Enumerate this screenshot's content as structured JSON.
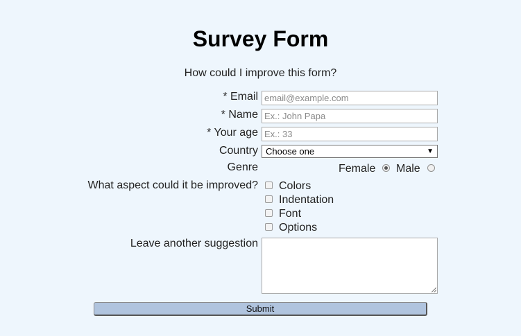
{
  "page": {
    "title": "Survey Form",
    "subtitle": "How could I improve this form?"
  },
  "form": {
    "email": {
      "label": "* Email",
      "placeholder": "email@example.com",
      "value": ""
    },
    "name": {
      "label": "* Name",
      "placeholder": "Ex.: John Papa",
      "value": ""
    },
    "age": {
      "label": "* Your age",
      "placeholder": "Ex.: 33",
      "value": ""
    },
    "country": {
      "label": "Country",
      "selected": "Choose one"
    },
    "genre": {
      "label": "Genre",
      "options": [
        {
          "label": "Female",
          "checked": true
        },
        {
          "label": "Male",
          "checked": false
        }
      ]
    },
    "aspects": {
      "label": "What aspect could it be improved?",
      "options": [
        {
          "label": "Colors",
          "checked": false
        },
        {
          "label": "Indentation",
          "checked": false
        },
        {
          "label": "Font",
          "checked": false
        },
        {
          "label": "Options",
          "checked": false
        }
      ]
    },
    "suggestion": {
      "label": "Leave another suggestion",
      "value": ""
    },
    "submit_label": "Submit"
  }
}
